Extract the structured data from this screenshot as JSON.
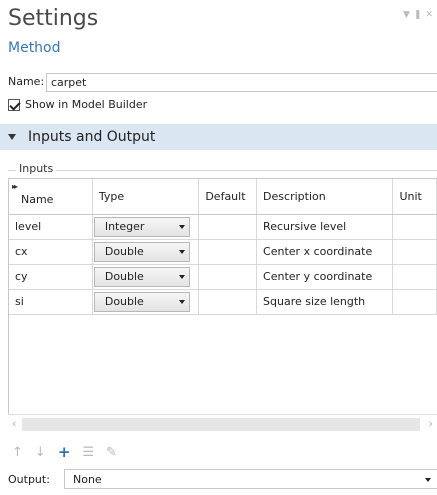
{
  "header": {
    "title": "Settings",
    "subtitle": "Method"
  },
  "name_field": {
    "label": "Name:",
    "value": "carpet"
  },
  "show_in_builder": {
    "label": "Show in Model Builder",
    "checked": true
  },
  "section": {
    "title": "Inputs and Output"
  },
  "inputs_group": {
    "title": "Inputs"
  },
  "table": {
    "columns": [
      "Name",
      "Type",
      "Default",
      "Description",
      "Unit"
    ],
    "rows": [
      {
        "name": "level",
        "type": "Integer",
        "default": "",
        "description": "Recursive level",
        "unit": ""
      },
      {
        "name": "cx",
        "type": "Double",
        "default": "",
        "description": "Center x coordinate",
        "unit": ""
      },
      {
        "name": "cy",
        "type": "Double",
        "default": "",
        "description": "Center y coordinate",
        "unit": ""
      },
      {
        "name": "si",
        "type": "Double",
        "default": "",
        "description": "Square size length",
        "unit": ""
      }
    ]
  },
  "toolbar": {
    "icons": [
      "arrow-up-icon",
      "arrow-down-icon",
      "add-icon",
      "delete-icon",
      "edit-icon"
    ]
  },
  "output": {
    "label": "Output:",
    "value": "None"
  },
  "colors": {
    "section_bg": "#dae6f2",
    "subtitle": "#3878b4",
    "add_icon": "#2a6fb8"
  }
}
